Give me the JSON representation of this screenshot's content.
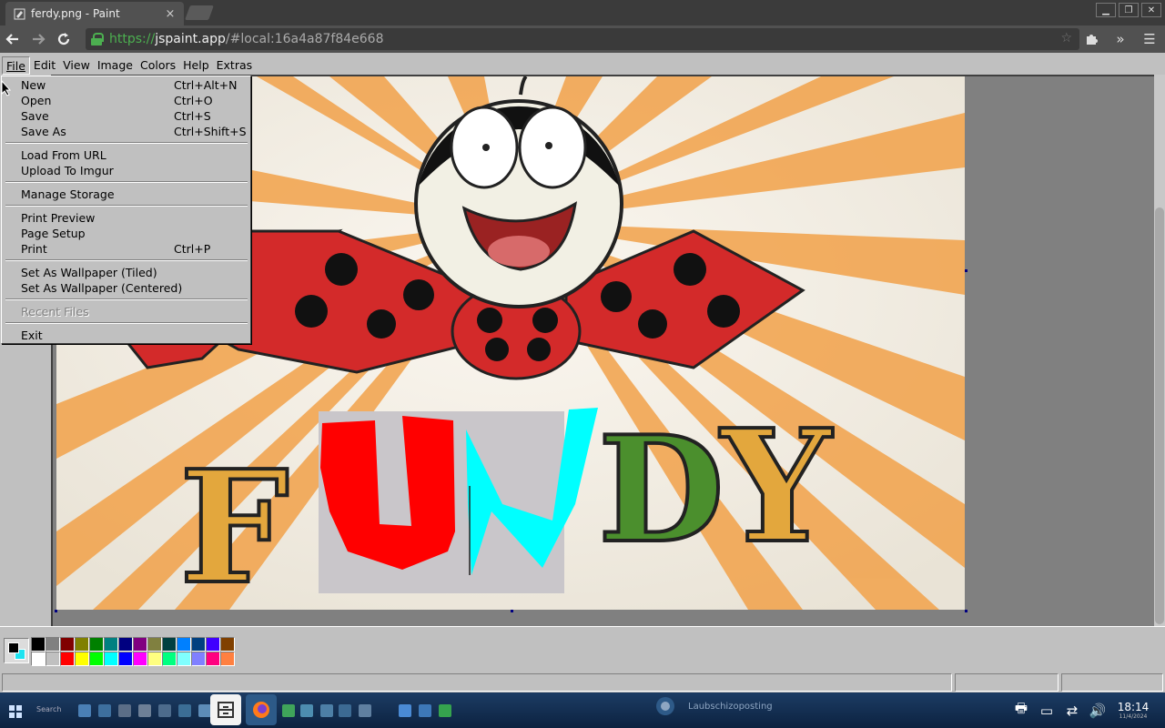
{
  "browser": {
    "tab_title": "ferdy.png - Paint",
    "tab_close": "×",
    "url_scheme": "https",
    "url_sep": "://",
    "url_host": "jspaint.app",
    "url_path": "/#local:16a4a87f84e668",
    "icons": {
      "back": "back-arrow-icon",
      "forward": "forward-arrow-icon",
      "reload": "reload-icon",
      "lock": "lock-icon",
      "extensions": "puzzle-icon",
      "more": "chevron-double-right-icon",
      "menu": "hamburger-menu-icon"
    }
  },
  "menubar": {
    "items": [
      "File",
      "Edit",
      "View",
      "Image",
      "Colors",
      "Help",
      "Extras"
    ]
  },
  "file_menu": {
    "items": [
      {
        "label": "New",
        "shortcut": "Ctrl+Alt+N"
      },
      {
        "label": "Open",
        "shortcut": "Ctrl+O"
      },
      {
        "label": "Save",
        "shortcut": "Ctrl+S"
      },
      {
        "label": "Save As",
        "shortcut": "Ctrl+Shift+S"
      },
      {
        "label": "Load From URL",
        "shortcut": ""
      },
      {
        "label": "Upload To Imgur",
        "shortcut": ""
      },
      {
        "label": "Manage Storage",
        "shortcut": ""
      },
      {
        "label": "Print Preview",
        "shortcut": ""
      },
      {
        "label": "Page Setup",
        "shortcut": ""
      },
      {
        "label": "Print",
        "shortcut": "Ctrl+P"
      },
      {
        "label": "Set As Wallpaper (Tiled)",
        "shortcut": ""
      },
      {
        "label": "Set As Wallpaper (Centered)",
        "shortcut": ""
      },
      {
        "label": "Recent Files",
        "shortcut": "",
        "disabled": true
      },
      {
        "label": "Exit",
        "shortcut": ""
      }
    ]
  },
  "canvas": {
    "fundy_letters": [
      "F",
      "U",
      "N",
      "D",
      "Y"
    ]
  },
  "palette": {
    "foreground": "#000000",
    "background": "#1ee3f0",
    "row1": [
      "#000000",
      "#808080",
      "#800000",
      "#808000",
      "#008000",
      "#008080",
      "#000080",
      "#800080",
      "#808040",
      "#004040",
      "#0080ff",
      "#004080",
      "#4000ff",
      "#804000"
    ],
    "row2": [
      "#ffffff",
      "#c0c0c0",
      "#ff0000",
      "#ffff00",
      "#00ff00",
      "#00ffff",
      "#0000ff",
      "#ff00ff",
      "#ffff80",
      "#00ff80",
      "#80ffff",
      "#8080ff",
      "#ff0080",
      "#ff8040"
    ]
  },
  "taskbar": {
    "notification_text": "Laubschizoposting",
    "time": "18:14",
    "date": "11/4/2024",
    "search": "Search"
  }
}
